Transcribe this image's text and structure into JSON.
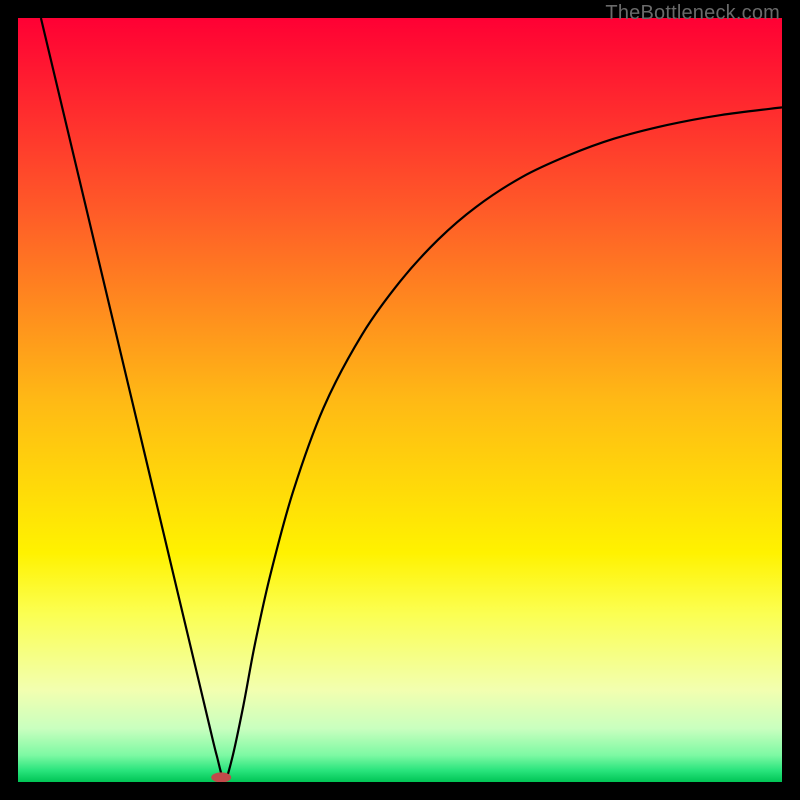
{
  "watermark": "TheBottleneck.com",
  "chart_data": {
    "type": "line",
    "title": "",
    "xlabel": "",
    "ylabel": "",
    "xlim": [
      0,
      100
    ],
    "ylim": [
      0,
      100
    ],
    "background_gradient": [
      {
        "stop": 0.0,
        "color": "#ff0034"
      },
      {
        "stop": 0.25,
        "color": "#ff5a28"
      },
      {
        "stop": 0.5,
        "color": "#ffb915"
      },
      {
        "stop": 0.7,
        "color": "#fff200"
      },
      {
        "stop": 0.78,
        "color": "#fbff52"
      },
      {
        "stop": 0.88,
        "color": "#f2ffb0"
      },
      {
        "stop": 0.93,
        "color": "#c9ffbf"
      },
      {
        "stop": 0.965,
        "color": "#7df9a3"
      },
      {
        "stop": 0.985,
        "color": "#29e47c"
      },
      {
        "stop": 1.0,
        "color": "#00c455"
      }
    ],
    "series": [
      {
        "name": "bottleneck-curve",
        "color": "#000000",
        "x": [
          3.0,
          6.0,
          9.0,
          12.0,
          15.0,
          18.0,
          21.0,
          23.5,
          25.0,
          26.0,
          27.0,
          28.0,
          29.5,
          31.0,
          33.0,
          36.0,
          40.0,
          45.0,
          50.0,
          55.0,
          60.0,
          66.0,
          72.0,
          78.0,
          85.0,
          92.0,
          100.0
        ],
        "y": [
          100.0,
          87.4,
          74.8,
          62.2,
          49.6,
          37.0,
          24.4,
          13.9,
          7.6,
          3.5,
          0.3,
          3.0,
          10.0,
          18.0,
          27.0,
          38.0,
          49.0,
          58.5,
          65.5,
          71.0,
          75.3,
          79.2,
          82.0,
          84.2,
          86.0,
          87.3,
          88.3
        ]
      }
    ],
    "marker": {
      "name": "optimal-point",
      "x": 26.6,
      "y": 0.6,
      "color": "#c24a4a",
      "rx": 10,
      "ry": 5
    }
  }
}
